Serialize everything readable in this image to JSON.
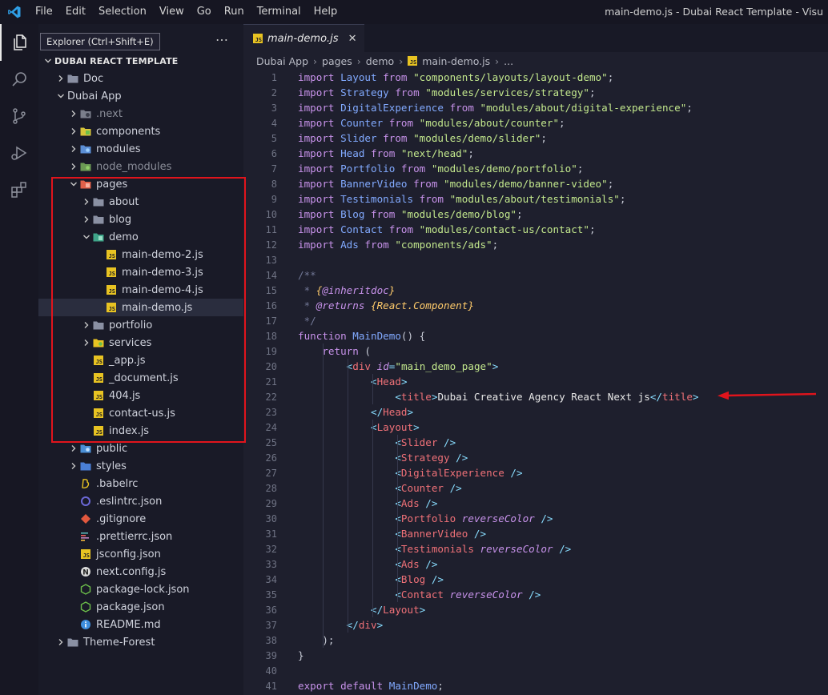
{
  "titlebar": {
    "menu": [
      "File",
      "Edit",
      "Selection",
      "View",
      "Go",
      "Run",
      "Terminal",
      "Help"
    ],
    "window_title": "main-demo.js - Dubai React Template - Visu"
  },
  "activity_bar": {
    "icons": [
      "files-icon",
      "search-icon",
      "source-control-icon",
      "run-debug-icon",
      "extensions-icon"
    ],
    "tooltip": "Explorer (Ctrl+Shift+E)"
  },
  "sidebar": {
    "more_actions": "…",
    "root_label": "DUBAI REACT TEMPLATE",
    "items": [
      {
        "label": "Doc",
        "chev": "right",
        "indent": 1,
        "icon": "folder-gray"
      },
      {
        "label": "Dubai App",
        "chev": "down",
        "indent": 1,
        "icon": "none"
      },
      {
        "label": ".next",
        "chev": "right",
        "indent": 2,
        "icon": "folder-next",
        "dim": true
      },
      {
        "label": "components",
        "chev": "right",
        "indent": 2,
        "icon": "folder-components"
      },
      {
        "label": "modules",
        "chev": "right",
        "indent": 2,
        "icon": "folder-modules"
      },
      {
        "label": "node_modules",
        "chev": "right",
        "indent": 2,
        "icon": "folder-node",
        "dim": true
      },
      {
        "label": "pages",
        "chev": "down",
        "indent": 2,
        "icon": "folder-pages"
      },
      {
        "label": "about",
        "chev": "right",
        "indent": 3,
        "icon": "folder-gray"
      },
      {
        "label": "blog",
        "chev": "right",
        "indent": 3,
        "icon": "folder-gray"
      },
      {
        "label": "demo",
        "chev": "down",
        "indent": 3,
        "icon": "folder-demo"
      },
      {
        "label": "main-demo-2.js",
        "chev": "none",
        "indent": 4,
        "icon": "js"
      },
      {
        "label": "main-demo-3.js",
        "chev": "none",
        "indent": 4,
        "icon": "js"
      },
      {
        "label": "main-demo-4.js",
        "chev": "none",
        "indent": 4,
        "icon": "js"
      },
      {
        "label": "main-demo.js",
        "chev": "none",
        "indent": 4,
        "icon": "js",
        "selected": true
      },
      {
        "label": "portfolio",
        "chev": "right",
        "indent": 3,
        "icon": "folder-gray"
      },
      {
        "label": "services",
        "chev": "right",
        "indent": 3,
        "icon": "folder-services"
      },
      {
        "label": "_app.js",
        "chev": "none",
        "indent": 3,
        "icon": "js"
      },
      {
        "label": "_document.js",
        "chev": "none",
        "indent": 3,
        "icon": "js"
      },
      {
        "label": "404.js",
        "chev": "none",
        "indent": 3,
        "icon": "js"
      },
      {
        "label": "contact-us.js",
        "chev": "none",
        "indent": 3,
        "icon": "js"
      },
      {
        "label": "index.js",
        "chev": "none",
        "indent": 3,
        "icon": "js"
      },
      {
        "label": "public",
        "chev": "right",
        "indent": 2,
        "icon": "folder-public"
      },
      {
        "label": "styles",
        "chev": "right",
        "indent": 2,
        "icon": "folder-styles"
      },
      {
        "label": ".babelrc",
        "chev": "none",
        "indent": 2,
        "icon": "babel"
      },
      {
        "label": ".eslintrc.json",
        "chev": "none",
        "indent": 2,
        "icon": "eslint"
      },
      {
        "label": ".gitignore",
        "chev": "none",
        "indent": 2,
        "icon": "git"
      },
      {
        "label": ".prettierrc.json",
        "chev": "none",
        "indent": 2,
        "icon": "prettier"
      },
      {
        "label": "jsconfig.json",
        "chev": "none",
        "indent": 2,
        "icon": "jsconfig"
      },
      {
        "label": "next.config.js",
        "chev": "none",
        "indent": 2,
        "icon": "next"
      },
      {
        "label": "package-lock.json",
        "chev": "none",
        "indent": 2,
        "icon": "node"
      },
      {
        "label": "package.json",
        "chev": "none",
        "indent": 2,
        "icon": "node"
      },
      {
        "label": "README.md",
        "chev": "none",
        "indent": 2,
        "icon": "info"
      },
      {
        "label": "Theme-Forest",
        "chev": "right",
        "indent": 1,
        "icon": "folder-gray"
      }
    ]
  },
  "editor": {
    "tab_label": "main-demo.js",
    "tab_close": "✕",
    "breadcrumbs": [
      "Dubai App",
      "pages",
      "demo",
      "main-demo.js",
      "..."
    ],
    "breadcrumb_sep": "›",
    "lines": [
      [
        [
          "k",
          "import "
        ],
        [
          "id",
          "Layout"
        ],
        [
          "k",
          " from "
        ],
        [
          "s",
          "\"components/layouts/layout-demo\""
        ],
        [
          "p",
          ";"
        ]
      ],
      [
        [
          "k",
          "import "
        ],
        [
          "id",
          "Strategy"
        ],
        [
          "k",
          " from "
        ],
        [
          "s",
          "\"modules/services/strategy\""
        ],
        [
          "p",
          ";"
        ]
      ],
      [
        [
          "k",
          "import "
        ],
        [
          "id",
          "DigitalExperience"
        ],
        [
          "k",
          " from "
        ],
        [
          "s",
          "\"modules/about/digital-experience\""
        ],
        [
          "p",
          ";"
        ]
      ],
      [
        [
          "k",
          "import "
        ],
        [
          "id",
          "Counter"
        ],
        [
          "k",
          " from "
        ],
        [
          "s",
          "\"modules/about/counter\""
        ],
        [
          "p",
          ";"
        ]
      ],
      [
        [
          "k",
          "import "
        ],
        [
          "id",
          "Slider"
        ],
        [
          "k",
          " from "
        ],
        [
          "s",
          "\"modules/demo/slider\""
        ],
        [
          "p",
          ";"
        ]
      ],
      [
        [
          "k",
          "import "
        ],
        [
          "id",
          "Head"
        ],
        [
          "k",
          " from "
        ],
        [
          "s",
          "\"next/head\""
        ],
        [
          "p",
          ";"
        ]
      ],
      [
        [
          "k",
          "import "
        ],
        [
          "id",
          "Portfolio"
        ],
        [
          "k",
          " from "
        ],
        [
          "s",
          "\"modules/demo/portfolio\""
        ],
        [
          "p",
          ";"
        ]
      ],
      [
        [
          "k",
          "import "
        ],
        [
          "id",
          "BannerVideo"
        ],
        [
          "k",
          " from "
        ],
        [
          "s",
          "\"modules/demo/banner-video\""
        ],
        [
          "p",
          ";"
        ]
      ],
      [
        [
          "k",
          "import "
        ],
        [
          "id",
          "Testimonials"
        ],
        [
          "k",
          " from "
        ],
        [
          "s",
          "\"modules/about/testimonials\""
        ],
        [
          "p",
          ";"
        ]
      ],
      [
        [
          "k",
          "import "
        ],
        [
          "id",
          "Blog"
        ],
        [
          "k",
          " from "
        ],
        [
          "s",
          "\"modules/demo/blog\""
        ],
        [
          "p",
          ";"
        ]
      ],
      [
        [
          "k",
          "import "
        ],
        [
          "id",
          "Contact"
        ],
        [
          "k",
          " from "
        ],
        [
          "s",
          "\"modules/contact-us/contact\""
        ],
        [
          "p",
          ";"
        ]
      ],
      [
        [
          "k",
          "import "
        ],
        [
          "id",
          "Ads"
        ],
        [
          "k",
          " from "
        ],
        [
          "s",
          "\"components/ads\""
        ],
        [
          "p",
          ";"
        ]
      ],
      [],
      [
        [
          "c",
          "/**"
        ]
      ],
      [
        [
          "c",
          " * "
        ],
        [
          "ct",
          "{"
        ],
        [
          "ci",
          "@inheritdoc"
        ],
        [
          "ct",
          "}"
        ]
      ],
      [
        [
          "c",
          " * "
        ],
        [
          "ci",
          "@returns "
        ],
        [
          "ct",
          "{React.Component}"
        ]
      ],
      [
        [
          "c",
          " */"
        ]
      ],
      [
        [
          "k",
          "function "
        ],
        [
          "fn",
          "MainDemo"
        ],
        [
          "p",
          "() {"
        ]
      ],
      [
        [
          "p",
          "    "
        ],
        [
          "k",
          "return"
        ],
        [
          "p",
          " ("
        ]
      ],
      [
        [
          "p",
          "        "
        ],
        [
          "pl",
          "<"
        ],
        [
          "tg",
          "div "
        ],
        [
          "at",
          "id"
        ],
        [
          "pl",
          "="
        ],
        [
          "s",
          "\"main_demo_page\""
        ],
        [
          "pl",
          ">"
        ]
      ],
      [
        [
          "p",
          "            "
        ],
        [
          "pl",
          "<"
        ],
        [
          "tg",
          "Head"
        ],
        [
          "pl",
          ">"
        ]
      ],
      [
        [
          "p",
          "                "
        ],
        [
          "pl",
          "<"
        ],
        [
          "tg",
          "title"
        ],
        [
          "pl",
          ">"
        ],
        [
          "txt",
          "Dubai Creative Agency React Next js"
        ],
        [
          "pl",
          "</"
        ],
        [
          "tg",
          "title"
        ],
        [
          "pl",
          ">"
        ]
      ],
      [
        [
          "p",
          "            "
        ],
        [
          "pl",
          "</"
        ],
        [
          "tg",
          "Head"
        ],
        [
          "pl",
          ">"
        ]
      ],
      [
        [
          "p",
          "            "
        ],
        [
          "pl",
          "<"
        ],
        [
          "tg",
          "Layout"
        ],
        [
          "pl",
          ">"
        ]
      ],
      [
        [
          "p",
          "                "
        ],
        [
          "pl",
          "<"
        ],
        [
          "tg",
          "Slider "
        ],
        [
          "pl",
          "/>"
        ]
      ],
      [
        [
          "p",
          "                "
        ],
        [
          "pl",
          "<"
        ],
        [
          "tg",
          "Strategy "
        ],
        [
          "pl",
          "/>"
        ]
      ],
      [
        [
          "p",
          "                "
        ],
        [
          "pl",
          "<"
        ],
        [
          "tg",
          "DigitalExperience "
        ],
        [
          "pl",
          "/>"
        ]
      ],
      [
        [
          "p",
          "                "
        ],
        [
          "pl",
          "<"
        ],
        [
          "tg",
          "Counter "
        ],
        [
          "pl",
          "/>"
        ]
      ],
      [
        [
          "p",
          "                "
        ],
        [
          "pl",
          "<"
        ],
        [
          "tg",
          "Ads "
        ],
        [
          "pl",
          "/>"
        ]
      ],
      [
        [
          "p",
          "                "
        ],
        [
          "pl",
          "<"
        ],
        [
          "tg",
          "Portfolio "
        ],
        [
          "at",
          "reverseColor "
        ],
        [
          "pl",
          "/>"
        ]
      ],
      [
        [
          "p",
          "                "
        ],
        [
          "pl",
          "<"
        ],
        [
          "tg",
          "BannerVideo "
        ],
        [
          "pl",
          "/>"
        ]
      ],
      [
        [
          "p",
          "                "
        ],
        [
          "pl",
          "<"
        ],
        [
          "tg",
          "Testimonials "
        ],
        [
          "at",
          "reverseColor "
        ],
        [
          "pl",
          "/>"
        ]
      ],
      [
        [
          "p",
          "                "
        ],
        [
          "pl",
          "<"
        ],
        [
          "tg",
          "Ads "
        ],
        [
          "pl",
          "/>"
        ]
      ],
      [
        [
          "p",
          "                "
        ],
        [
          "pl",
          "<"
        ],
        [
          "tg",
          "Blog "
        ],
        [
          "pl",
          "/>"
        ]
      ],
      [
        [
          "p",
          "                "
        ],
        [
          "pl",
          "<"
        ],
        [
          "tg",
          "Contact "
        ],
        [
          "at",
          "reverseColor "
        ],
        [
          "pl",
          "/>"
        ]
      ],
      [
        [
          "p",
          "            "
        ],
        [
          "pl",
          "</"
        ],
        [
          "tg",
          "Layout"
        ],
        [
          "pl",
          ">"
        ]
      ],
      [
        [
          "p",
          "        "
        ],
        [
          "pl",
          "</"
        ],
        [
          "tg",
          "div"
        ],
        [
          "pl",
          ">"
        ]
      ],
      [
        [
          "p",
          "    );"
        ]
      ],
      [
        [
          "p",
          "}"
        ]
      ],
      [],
      [
        [
          "k",
          "export default "
        ],
        [
          "fn",
          "MainDemo"
        ],
        [
          "p",
          ";"
        ]
      ]
    ]
  },
  "colors": {
    "annotation_red": "#e0141c",
    "js_badge": "#e8c322"
  }
}
